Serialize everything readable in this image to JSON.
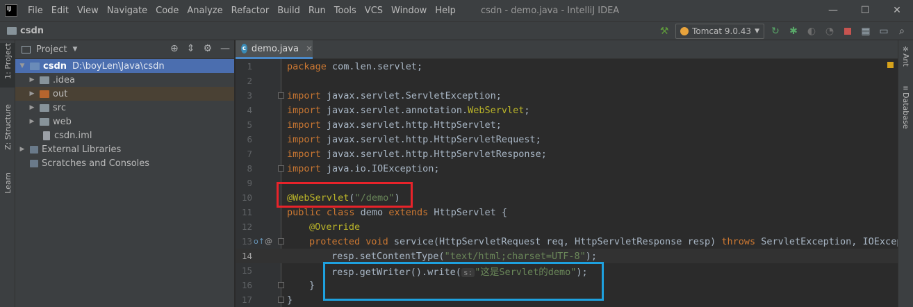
{
  "menu": {
    "items": [
      "File",
      "Edit",
      "View",
      "Navigate",
      "Code",
      "Analyze",
      "Refactor",
      "Build",
      "Run",
      "Tools",
      "VCS",
      "Window",
      "Help"
    ],
    "window_title": "csdn - demo.java - IntelliJ IDEA"
  },
  "window_controls": {
    "minimize": "—",
    "maximize": "☐",
    "close": "✕"
  },
  "navbar": {
    "breadcrumb": "csdn",
    "run_config": "Tomcat 9.0.43"
  },
  "left_strip": {
    "project_tab": "1: Project",
    "structure_tab": "Z: Structure",
    "learn_tab": "Learn"
  },
  "right_strip": {
    "ant_tab": "Ant",
    "database_tab": "Database"
  },
  "project_panel": {
    "title": "Project",
    "tree": [
      {
        "label": "csdn",
        "path": "D:\\boyLen\\Java\\csdn",
        "arrow": "▼"
      },
      {
        "label": ".idea",
        "arrow": "▶"
      },
      {
        "label": "out",
        "arrow": "▶"
      },
      {
        "label": "src",
        "arrow": "▶"
      },
      {
        "label": "web",
        "arrow": "▶"
      },
      {
        "label": "csdn.iml",
        "arrow": ""
      },
      {
        "label": "External Libraries",
        "arrow": "▶"
      },
      {
        "label": "Scratches and Consoles",
        "arrow": ""
      }
    ]
  },
  "editor": {
    "tab_label": "demo.java",
    "tab_icon_letter": "c",
    "line_numbers": [
      "1",
      "2",
      "3",
      "4",
      "5",
      "6",
      "7",
      "8",
      "9",
      "10",
      "11",
      "12",
      "13",
      "14",
      "15",
      "16",
      "17"
    ],
    "code": {
      "l1_kw": "package",
      "l1_rest": " com.len.servlet;",
      "import_kw": "import",
      "l3": " javax.servlet.ServletException;",
      "l4_a": " javax.servlet.annotation.",
      "l4_b": "WebServlet",
      "l4_c": ";",
      "l5": " javax.servlet.http.HttpServlet;",
      "l6": " javax.servlet.http.HttpServletRequest;",
      "l7": " javax.servlet.http.HttpServletResponse;",
      "l8": " java.io.IOException;",
      "l10_ann": "@WebServlet",
      "l10_open": "(",
      "l10_str": "\"/demo\"",
      "l10_close": ")",
      "l11_kw1": "public class",
      "l11_name": " demo ",
      "l11_kw2": "extends",
      "l11_rest": " HttpServlet {",
      "l12_ann": "@Override",
      "l13_kw": "protected void",
      "l13_rest": " service(HttpServletRequest req, HttpServletResponse resp) ",
      "l13_throws": "throws",
      "l13_tail": " ServletException, IOExcept",
      "l14_a": "resp.setContentType(",
      "l14_str": "\"text/html;charset=UTF-8\"",
      "l14_b": ");",
      "l15_a": "resp.getWriter().write(",
      "l15_hint": "s:",
      "l15_str": "\"这是Servlet的demo\"",
      "l15_b": ");",
      "l16": "}",
      "l17": "}"
    },
    "gutter_marks": {
      "override": "o↑",
      "annotation": "@"
    }
  },
  "colors": {
    "keyword": "#cc7832",
    "annotation": "#bbb529",
    "string": "#6a8759",
    "highlight_red": "#e8232a",
    "highlight_blue": "#1ea1df"
  }
}
